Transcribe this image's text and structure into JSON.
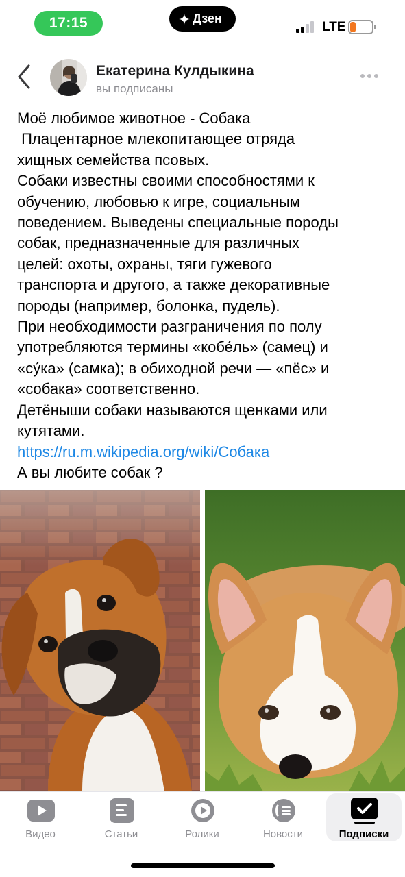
{
  "status_bar": {
    "time": "17:15",
    "app_pill": "Дзен",
    "network": "LTE",
    "battery_level": 0.25,
    "colors": {
      "time_pill": "#35c759",
      "battery": "#f2771f"
    }
  },
  "header": {
    "author_name": "Екатерина Кулдыкина",
    "author_status": "вы подписаны",
    "icons": {
      "back": "chevron-left-icon",
      "more": "more-dots-icon"
    }
  },
  "article": {
    "lines": [
      "Моё любимое животное - Собака",
      " Плацентарное млекопитающее отряда",
      "хищных семейства псовых.",
      "Собаки известны своими способностями к",
      "обучению, любовью к игре, социальным",
      "поведением. Выведены специальные породы",
      "собак, предназначенные для различных",
      "целей: охоты, охраны, тяги гужевого",
      "транспорта и другого, а также декоративные",
      "породы (например, болонка, пудель).",
      "При необходимости разграничения по полу",
      "употребляются термины «кобе́ль» (самец) и",
      "«су́ка» (самка); в обиходной речи — «пёс» и",
      "«собака» соответственно.",
      "Детёныши собаки называются щенками или",
      "кутятами."
    ],
    "link": "https://ru.m.wikipedia.org/wiki/Собака",
    "closing": "А вы любите собак ?",
    "link_color": "#1e88e5"
  },
  "photos": [
    {
      "subject": "boxer-dog-photo"
    },
    {
      "subject": "corgi-puppy-photo"
    }
  ],
  "tabbar": {
    "tabs": [
      {
        "label": "Видео",
        "icon": "video-icon"
      },
      {
        "label": "Статьи",
        "icon": "articles-icon"
      },
      {
        "label": "Ролики",
        "icon": "clips-icon"
      },
      {
        "label": "Новости",
        "icon": "news-icon"
      },
      {
        "label": "Подписки",
        "icon": "subscriptions-icon",
        "active": true
      }
    ]
  }
}
